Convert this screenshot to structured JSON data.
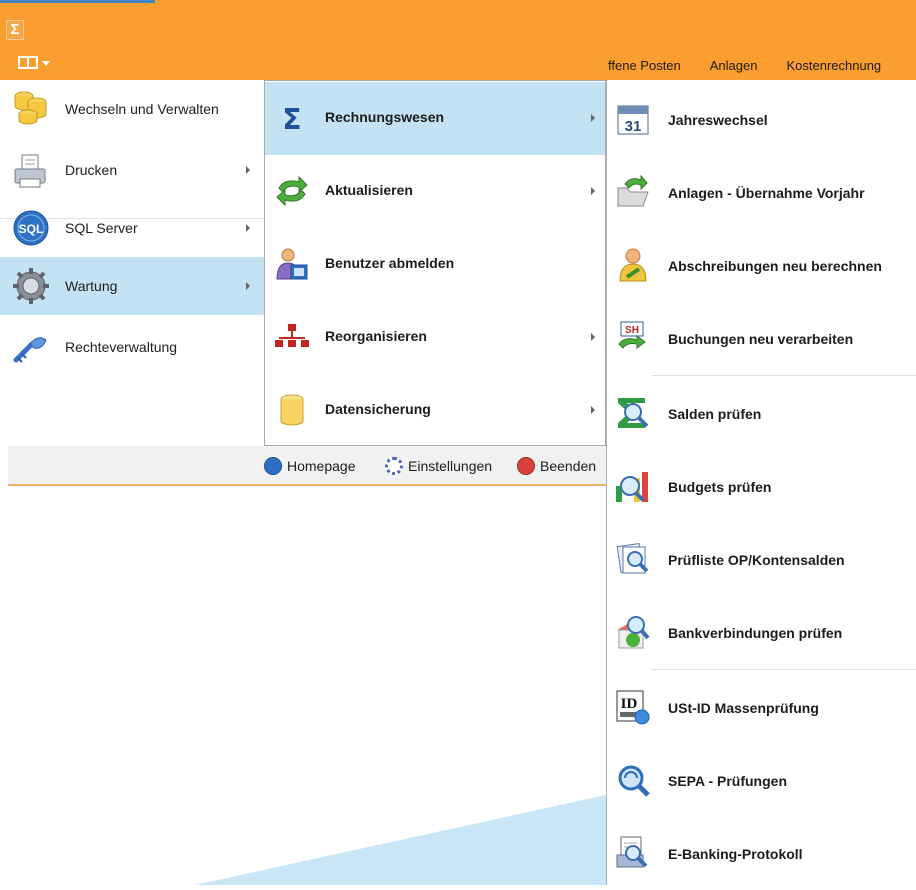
{
  "app": {
    "sigma_glyph": "Σ",
    "ribbon_tabs": [
      "ffene Posten",
      "Anlagen",
      "Kostenrechnung"
    ]
  },
  "menu_level1": {
    "items": [
      {
        "label": "Wechseln und Verwalten",
        "icon": "database-icon",
        "submenu": false
      },
      {
        "label": "Drucken",
        "icon": "printer-icon",
        "submenu": true
      },
      {
        "label": "SQL Server",
        "icon": "sql-icon",
        "submenu": true
      },
      {
        "label": "Wartung",
        "icon": "gear-icon",
        "submenu": true,
        "selected": true
      },
      {
        "label": "Rechteverwaltung",
        "icon": "key-icon",
        "submenu": false
      }
    ]
  },
  "footer": {
    "homepage": "Homepage",
    "settings": "Einstellungen",
    "exit": "Beenden"
  },
  "menu_level2": {
    "items": [
      {
        "label": "Rechnungswesen",
        "icon": "sigma-icon",
        "submenu": true,
        "selected": true
      },
      {
        "label": "Aktualisieren",
        "icon": "refresh-icon",
        "submenu": true
      },
      {
        "label": "Benutzer abmelden",
        "icon": "user-logoff-icon",
        "submenu": false
      },
      {
        "label": "Reorganisieren",
        "icon": "hierarchy-icon",
        "submenu": true
      },
      {
        "label": "Datensicherung",
        "icon": "cylinder-icon",
        "submenu": true
      }
    ]
  },
  "menu_level3": {
    "items": [
      {
        "label": "Jahreswechsel",
        "icon": "calendar-icon",
        "calendar_day": "31"
      },
      {
        "label": "Anlagen - Übernahme Vorjahr",
        "icon": "folder-refresh-icon"
      },
      {
        "label": "Abschreibungen neu berechnen",
        "icon": "person-calc-icon"
      },
      {
        "label": "Buchungen neu verarbeiten",
        "icon": "sh-refresh-icon",
        "icon_text": "SH"
      },
      {
        "label": "Salden prüfen",
        "icon": "sum-magnifier-icon"
      },
      {
        "label": "Budgets prüfen",
        "icon": "chart-magnifier-icon"
      },
      {
        "label": "Prüfliste OP/Kontensalden",
        "icon": "list-magnifier-icon"
      },
      {
        "label": "Bankverbindungen prüfen",
        "icon": "bank-magnifier-icon"
      },
      {
        "label": "USt-ID Massenprüfung",
        "icon": "id-globe-icon",
        "icon_text": "ID"
      },
      {
        "label": "SEPA - Prüfungen",
        "icon": "sepa-magnifier-icon"
      },
      {
        "label": "E-Banking-Protokoll",
        "icon": "ebanking-magnifier-icon"
      }
    ]
  },
  "colors": {
    "orange": "#fb9d2f",
    "selection": "#c3e3f4",
    "accent_blue": "#3f86c6"
  }
}
